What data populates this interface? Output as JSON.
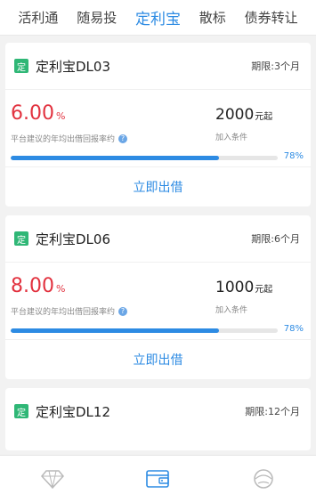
{
  "tabs": [
    {
      "label": "活利通"
    },
    {
      "label": "随易投"
    },
    {
      "label": "定利宝"
    },
    {
      "label": "散标"
    },
    {
      "label": "债券转让"
    }
  ],
  "active_tab_index": 2,
  "products": [
    {
      "badge": "定",
      "name": "定利宝DL03",
      "period": "期限:3个月",
      "rate_value": "6.00",
      "rate_unit": "%",
      "rate_desc": "平台建议的年均出借回报率约",
      "amount_value": "2000",
      "amount_unit": "元起",
      "amount_desc": "加入条件",
      "progress_label": "78%",
      "progress_fraction": 0.78,
      "action_label": "立即出借"
    },
    {
      "badge": "定",
      "name": "定利宝DL06",
      "period": "期限:6个月",
      "rate_value": "8.00",
      "rate_unit": "%",
      "rate_desc": "平台建议的年均出借回报率约",
      "amount_value": "1000",
      "amount_unit": "元起",
      "amount_desc": "加入条件",
      "progress_label": "78%",
      "progress_fraction": 0.78,
      "action_label": "立即出借"
    },
    {
      "badge": "定",
      "name": "定利宝DL12",
      "period": "期限:12个月"
    }
  ],
  "bottom_nav": [
    {
      "icon": "diamond-icon"
    },
    {
      "icon": "wallet-icon"
    },
    {
      "icon": "user-icon"
    }
  ],
  "colors": {
    "accent": "#2d8be3",
    "rate": "#e2323f",
    "badge": "#2fb776"
  }
}
